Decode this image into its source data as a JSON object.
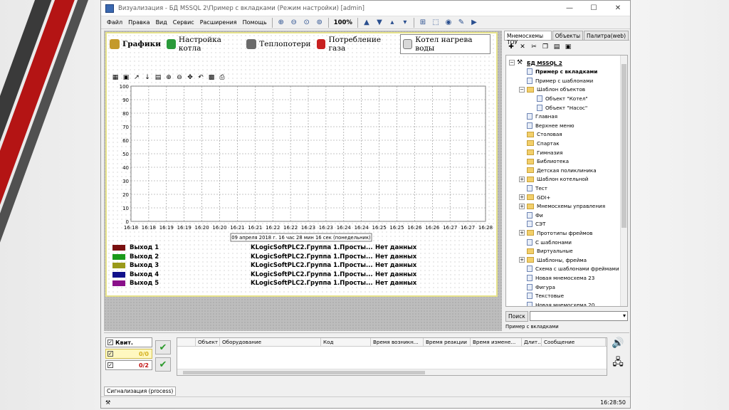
{
  "window": {
    "title": "Визуализация - БД MSSQL 2\\Пример с вкладками (Режим настройки) [admin]",
    "min": "—",
    "max": "☐",
    "close": "✕"
  },
  "menu": [
    "Файл",
    "Правка",
    "Вид",
    "Сервис",
    "Расширения",
    "Помощь"
  ],
  "zoom": "100%",
  "tabs": [
    {
      "label": "Графики",
      "color": "#c49a2a",
      "active": true
    },
    {
      "label": "Настройка котла",
      "color": "#2a9a3a",
      "active": false
    },
    {
      "label": "Теплопотери",
      "color": "#6a6a6a",
      "active": false
    },
    {
      "label": "Потребление газа",
      "color": "#c82020",
      "active": false
    },
    {
      "label": "Котел нагрева воды",
      "color": "#d8d8d8",
      "active": false
    }
  ],
  "chart_data": {
    "type": "line",
    "title": "",
    "xlabel": "",
    "ylabel": "",
    "ylim": [
      0,
      100
    ],
    "yticks": [
      0,
      10,
      20,
      30,
      40,
      50,
      60,
      70,
      80,
      90,
      100
    ],
    "categories": [
      "16:18",
      "16:18",
      "16:19",
      "16:19",
      "16:20",
      "16:20",
      "16:21",
      "16:21",
      "16:22",
      "16:22",
      "16:23",
      "16:23",
      "16:24",
      "16:24",
      "16:25",
      "16:25",
      "16:26",
      "16:26",
      "16:27",
      "16:27",
      "16:28"
    ],
    "series": [],
    "grid": true,
    "cursor_label": "09 апреля 2018 г. 16 час 28 мин 16 сек (понедельник)"
  },
  "legend": [
    {
      "name": "Выход 1",
      "color": "#7a1010",
      "source": "KLogicSoftPLC2.Группа 1.Просты...",
      "status": "Нет данных"
    },
    {
      "name": "Выход 2",
      "color": "#1a9a1a",
      "source": "KLogicSoftPLC2.Группа 1.Просты...",
      "status": "Нет данных"
    },
    {
      "name": "Выход 3",
      "color": "#9a9a1a",
      "source": "KLogicSoftPLC2.Группа 1.Просты...",
      "status": "Нет данных"
    },
    {
      "name": "Выход 4",
      "color": "#10108a",
      "source": "KLogicSoftPLC2.Группа 1.Просты...",
      "status": "Нет данных"
    },
    {
      "name": "Выход 5",
      "color": "#8a108a",
      "source": "KLogicSoftPLC2.Группа 1.Просты...",
      "status": "Нет данных"
    }
  ],
  "right_panel": {
    "tabs": [
      "Мнемосхемы ТОУ",
      "Объекты",
      "Палитра(web)"
    ],
    "tree": [
      {
        "label": "БД MSSQL 2",
        "level": 0,
        "kind": "root",
        "exp": "−"
      },
      {
        "label": "Пример с вкладками",
        "level": 1,
        "kind": "page",
        "exp": "",
        "bold": true
      },
      {
        "label": "Пример с шаблонами",
        "level": 1,
        "kind": "page",
        "exp": ""
      },
      {
        "label": "Шаблон объектов",
        "level": 1,
        "kind": "folder",
        "exp": "−"
      },
      {
        "label": "Объект \"Котел\"",
        "level": 2,
        "kind": "page",
        "exp": ""
      },
      {
        "label": "Объект \"Насос\"",
        "level": 2,
        "kind": "page",
        "exp": ""
      },
      {
        "label": "Главная",
        "level": 1,
        "kind": "page",
        "exp": ""
      },
      {
        "label": "Верхнее меню",
        "level": 1,
        "kind": "page",
        "exp": ""
      },
      {
        "label": "Столовая",
        "level": 1,
        "kind": "folder",
        "exp": ""
      },
      {
        "label": "Спартак",
        "level": 1,
        "kind": "folder",
        "exp": ""
      },
      {
        "label": "Гимназия",
        "level": 1,
        "kind": "folder",
        "exp": ""
      },
      {
        "label": "Библиотека",
        "level": 1,
        "kind": "folder",
        "exp": ""
      },
      {
        "label": "Детская поликлиника",
        "level": 1,
        "kind": "folder",
        "exp": ""
      },
      {
        "label": "Шаблон котельной",
        "level": 1,
        "kind": "folder",
        "exp": "+"
      },
      {
        "label": "Тест",
        "level": 1,
        "kind": "page",
        "exp": ""
      },
      {
        "label": "GDI+",
        "level": 1,
        "kind": "folder",
        "exp": "+"
      },
      {
        "label": "Мнемосхемы управления",
        "level": 1,
        "kind": "folder",
        "exp": "+"
      },
      {
        "label": "Фи",
        "level": 1,
        "kind": "page",
        "exp": ""
      },
      {
        "label": "СЭТ",
        "level": 1,
        "kind": "page",
        "exp": ""
      },
      {
        "label": "Прототипы фреймов",
        "level": 1,
        "kind": "folder",
        "exp": "+"
      },
      {
        "label": "С шаблонами",
        "level": 1,
        "kind": "page",
        "exp": ""
      },
      {
        "label": "Виртуальные",
        "level": 1,
        "kind": "folder",
        "exp": ""
      },
      {
        "label": "Шаблоны, фрейма",
        "level": 1,
        "kind": "folder",
        "exp": "+"
      },
      {
        "label": "Схема с шаблонами фреймами",
        "level": 1,
        "kind": "page",
        "exp": ""
      },
      {
        "label": "Новая мнемосхема 23",
        "level": 1,
        "kind": "page",
        "exp": ""
      },
      {
        "label": "Фигура",
        "level": 1,
        "kind": "page",
        "exp": ""
      },
      {
        "label": "Текстовые",
        "level": 1,
        "kind": "page",
        "exp": ""
      },
      {
        "label": "Новая мнемосхема 20",
        "level": 1,
        "kind": "page",
        "exp": ""
      }
    ],
    "search_label": "Поиск",
    "path": "Пример с вкладками"
  },
  "alarms": {
    "kvit_label": "Квит.",
    "count1": "0/0",
    "count2": "0/2",
    "columns": [
      "",
      "Объект",
      "Оборудование",
      "Код",
      "Время возникн...",
      "Время реакции",
      "Время измене...",
      "Длит...",
      "Сообщение"
    ],
    "tab_label": "Сигнализация (process)"
  },
  "status": {
    "time": "16:28:50"
  }
}
